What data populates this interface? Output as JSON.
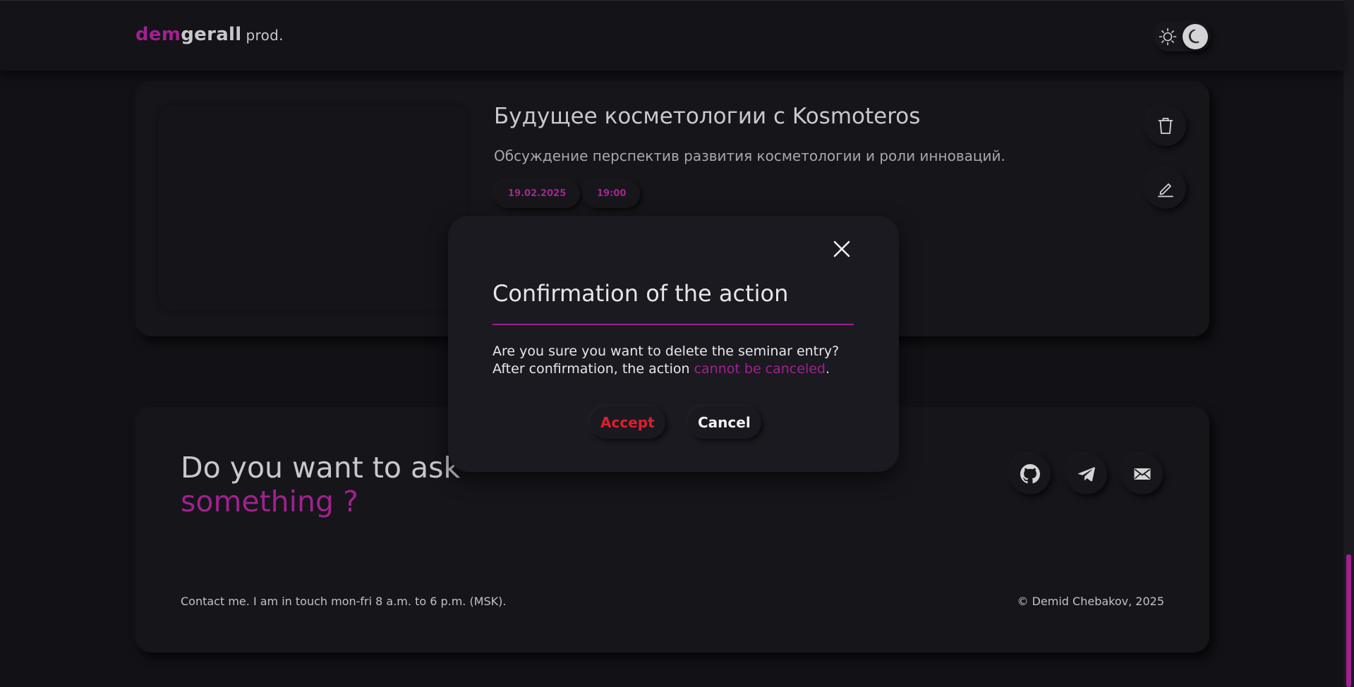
{
  "header": {
    "logo_part1": "dem",
    "logo_part2": "gerall",
    "logo_suffix": "prod.",
    "theme_toggle_icons": [
      "sun-icon",
      "moon-icon"
    ]
  },
  "seminar": {
    "title": "Будущее косметологии с Kosmoteros",
    "description": "Обсуждение перспектив развития косметологии и роли инноваций.",
    "date": "19.02.2025",
    "time": "19:00"
  },
  "footer": {
    "ask_line1": "Do you want to ask",
    "ask_line2": "something ?",
    "contact": "Contact me. I am in touch mon-fri 8 a.m. to 6 p.m. (MSK).",
    "copyright": "© Demid Chebakov, 2025",
    "social_icons": [
      "github-icon",
      "telegram-icon",
      "mail-icon"
    ]
  },
  "modal": {
    "title": "Confirmation of the action",
    "line1": "Are you sure you want to delete the seminar entry?",
    "line2_prefix": "After confirmation, the action ",
    "line2_highlight": "cannot be canceled",
    "line2_suffix": ".",
    "accept_label": "Accept",
    "cancel_label": "Cancel"
  },
  "colors": {
    "accent": "#a0218f",
    "danger": "#d8212f",
    "background": "#121116"
  }
}
